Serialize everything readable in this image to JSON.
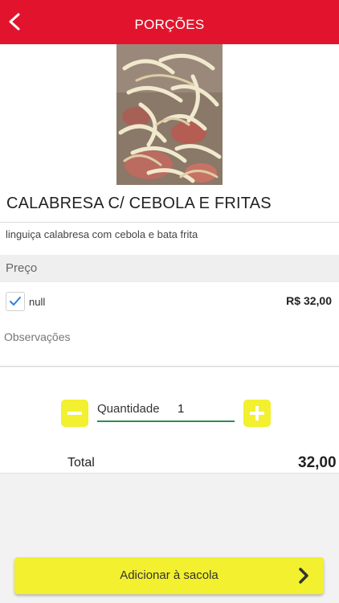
{
  "header": {
    "title": "PORÇÕES",
    "accent_color": "#e2142d",
    "back_icon": "chevron-left-icon"
  },
  "product": {
    "image_icon": "food-photo",
    "name": "CALABRESA C/ CEBOLA E FRITAS",
    "description": "linguiça calabresa com cebola e bata frita"
  },
  "price_section": {
    "label": "Preço",
    "options": [
      {
        "label": "null",
        "price": "R$ 32,00",
        "checked": true
      }
    ]
  },
  "observations": {
    "placeholder": "Observações",
    "value": ""
  },
  "quantity": {
    "label": "Quantidade",
    "value": "1",
    "minus_icon": "minus-icon",
    "plus_icon": "plus-icon",
    "button_color": "#f2f02f"
  },
  "total": {
    "label": "Total",
    "value": "32,00"
  },
  "cart": {
    "button_label": "Adicionar à sacola",
    "arrow_icon": "chevron-right-icon"
  }
}
